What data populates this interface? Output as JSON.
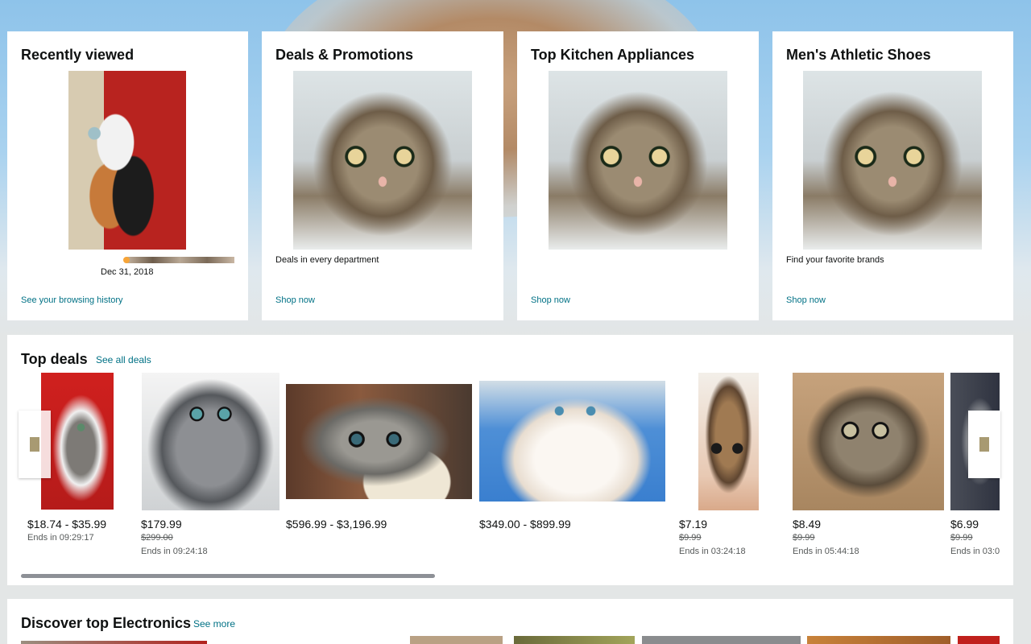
{
  "cards": [
    {
      "title": "Recently viewed",
      "subtitle": "Dec 31, 2018",
      "link": "See your browsing history"
    },
    {
      "title": "Deals & Promotions",
      "subtitle": "Deals in every department",
      "link": "Shop now"
    },
    {
      "title": "Top Kitchen Appliances",
      "subtitle": "",
      "link": "Shop now"
    },
    {
      "title": "Men's Athletic Shoes",
      "subtitle": "Find your favorite brands",
      "link": "Shop now"
    }
  ],
  "top_deals": {
    "title": "Top deals",
    "see_all": "See all deals",
    "items": [
      {
        "price": "$18.74 - $35.99",
        "list_price": "",
        "ends": "Ends in 09:29:17"
      },
      {
        "price": "$179.99",
        "list_price": "$299.00",
        "ends": "Ends in 09:24:18"
      },
      {
        "price": "$596.99 - $3,196.99",
        "list_price": "",
        "ends": ""
      },
      {
        "price": "$349.00 - $899.99",
        "list_price": "",
        "ends": ""
      },
      {
        "price": "$7.19",
        "list_price": "$9.99",
        "ends": "Ends in 03:24:18"
      },
      {
        "price": "$8.49",
        "list_price": "$9.99",
        "ends": "Ends in 05:44:18"
      },
      {
        "price": "$6.99",
        "list_price": "$9.99",
        "ends": "Ends in 03:0"
      }
    ]
  },
  "electronics": {
    "title": "Discover top Electronics",
    "see_more": "See more"
  },
  "colors": {
    "link": "#007185",
    "text": "#0f1111",
    "page_bg": "#e3e6e6",
    "accent": "#f7a538"
  }
}
